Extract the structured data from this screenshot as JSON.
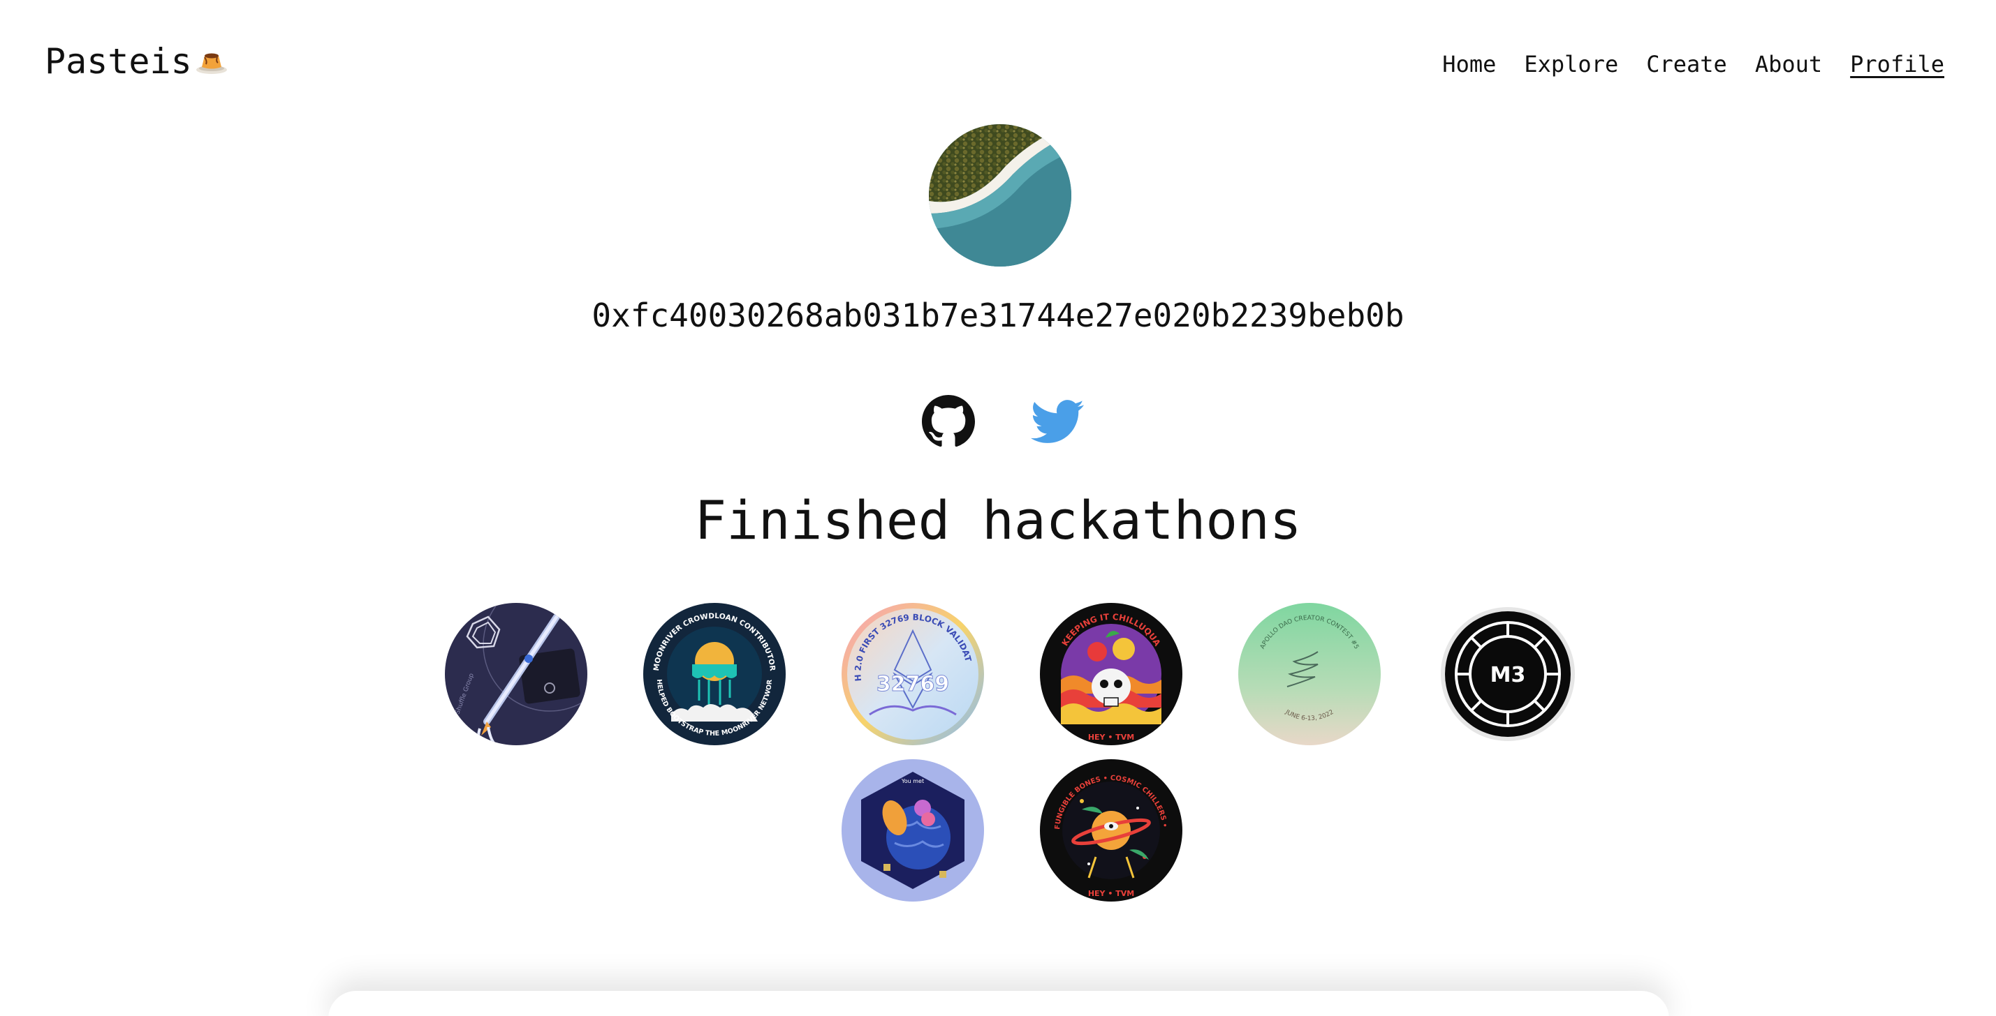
{
  "brand": {
    "name": "Pasteis",
    "emoji_icon": "flan-icon"
  },
  "nav": {
    "items": [
      {
        "label": "Home"
      },
      {
        "label": "Explore"
      },
      {
        "label": "Create"
      },
      {
        "label": "About"
      },
      {
        "label": "Profile",
        "active": true
      }
    ]
  },
  "profile": {
    "avatar_icon": "beach-aerial-photo",
    "address": "0xfc40030268ab031b7e31744e27e020b2239beb0b",
    "socials": [
      {
        "name": "GitHub",
        "icon": "github-icon",
        "color": "#111111"
      },
      {
        "name": "Twitter",
        "icon": "twitter-icon",
        "color": "#4a9fe8"
      }
    ]
  },
  "hackathons": {
    "title": "Finished hackathons",
    "badges": [
      {
        "name": "rocket-badge",
        "texts": [
          "Shuffle Group"
        ]
      },
      {
        "name": "moonriver-crowdloan-badge",
        "texts": [
          "MOONRIVER CROWDLOAN CONTRIBUTOR",
          "I HELPED BOOTSTRAP THE MOONRIVER NETWORK"
        ]
      },
      {
        "name": "eth2-validator-badge",
        "texts": [
          "ETH 2.0 FIRST 32769 BLOCK VALIDATOR",
          "32769"
        ]
      },
      {
        "name": "keeping-it-chilluqua-badge",
        "texts": [
          "KEEPING IT CHILLUQUA",
          "HEY • TVM"
        ]
      },
      {
        "name": "apollo-dao-creator-contest-badge",
        "texts": [
          "APOLLO DAO CREATOR CONTEST #5",
          "JUNE 6-13, 2022"
        ]
      },
      {
        "name": "m3-badge",
        "texts": [
          "M3"
        ]
      },
      {
        "name": "you-met-badge",
        "texts": [
          "You met"
        ]
      },
      {
        "name": "cosmic-chillers-badge",
        "texts": [
          "NON FUNGIBLE BONES • COSMIC CHILLERS • 0010",
          "HEY • TVM"
        ]
      }
    ]
  }
}
